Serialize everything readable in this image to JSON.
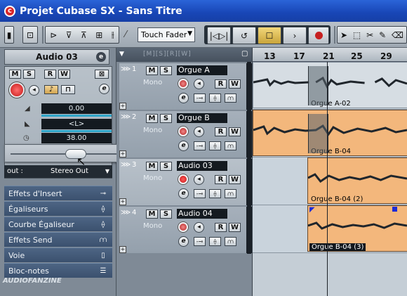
{
  "window": {
    "title": "Projet Cubase SX - Sans Titre",
    "app_icon": "cubase-logo-icon"
  },
  "toolbar": {
    "fader_mode": "Touch Fader",
    "transport_colors": {
      "stop_active": "#e2c35a",
      "record": "#c62020"
    }
  },
  "inspector": {
    "track_name": "Audio 03",
    "edit_button": "e",
    "buttons": {
      "mute": "M",
      "solo": "S",
      "read": "R",
      "write": "W"
    },
    "volume": "0.00",
    "pan": "<L>",
    "delay": "38.00",
    "output_label": "out :",
    "output_value": "Stereo Out",
    "sections": [
      {
        "label": "Effets d'Insert"
      },
      {
        "label": "Égaliseurs"
      },
      {
        "label": "Courbe Égaliseur"
      },
      {
        "label": "Effets Send"
      },
      {
        "label": "Voie"
      },
      {
        "label": "Bloc-notes"
      }
    ]
  },
  "tracks": [
    {
      "num": "1",
      "name": "Orgue A",
      "mode": "Mono",
      "m": "M",
      "s": "S",
      "r": "R",
      "w": "W",
      "e": "e"
    },
    {
      "num": "2",
      "name": "Orgue B",
      "mode": "Mono",
      "m": "M",
      "s": "S",
      "r": "R",
      "w": "W",
      "e": "e"
    },
    {
      "num": "3",
      "name": "Audio 03",
      "mode": "Mono",
      "m": "M",
      "s": "S",
      "r": "R",
      "w": "W",
      "e": "e"
    },
    {
      "num": "4",
      "name": "Audio 04",
      "mode": "Mono",
      "m": "M",
      "s": "S",
      "r": "R",
      "w": "W",
      "e": "e"
    }
  ],
  "ruler": {
    "marks": [
      "13",
      "17",
      "21",
      "25",
      "29"
    ]
  },
  "events": [
    {
      "label": "Orgue A-02"
    },
    {
      "label": "Orgue B-04"
    },
    {
      "label": "Orgue B-04 (2)"
    },
    {
      "label": "Orgue B-04 (3)"
    }
  ],
  "watermark": "AUDIOFANZINE"
}
